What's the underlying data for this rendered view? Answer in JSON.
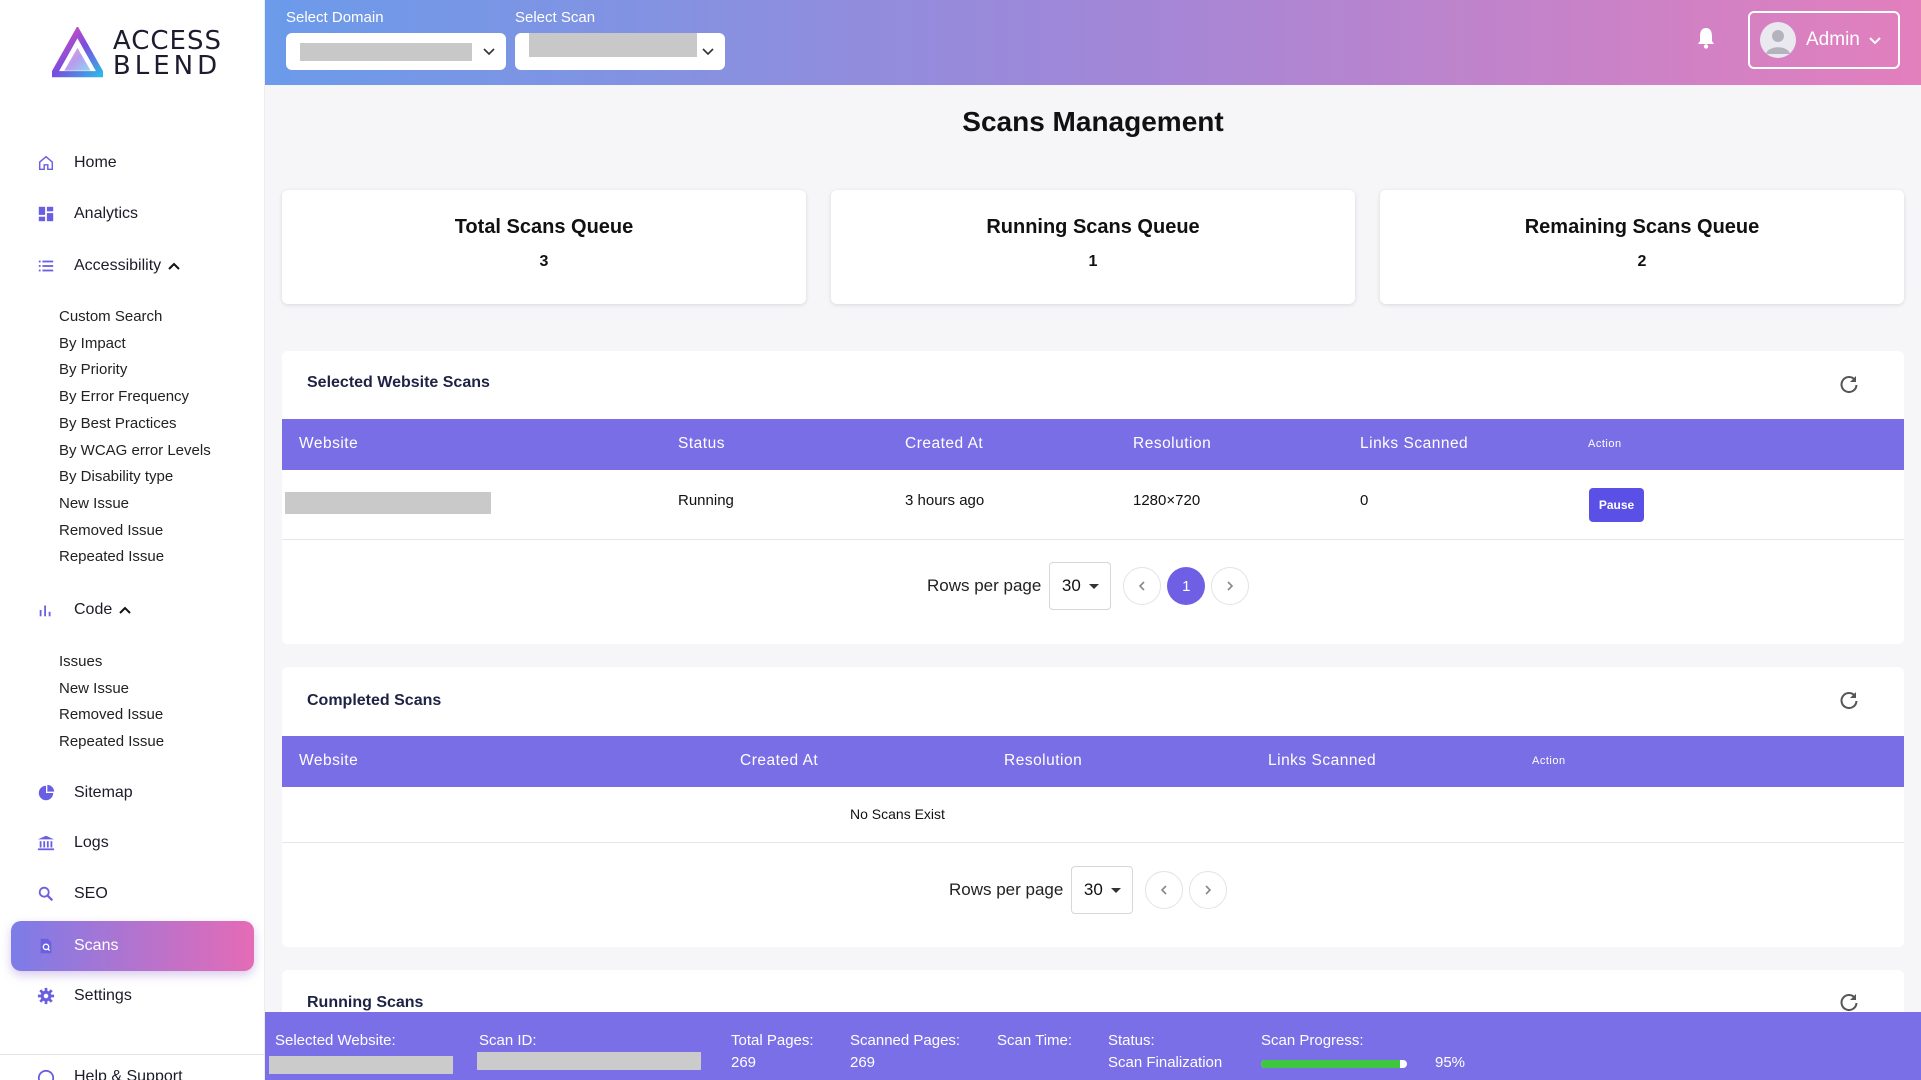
{
  "logo": {
    "line1": "ACCESS",
    "line2": "BLEND"
  },
  "sidebar": {
    "nav": {
      "home": "Home",
      "analytics": "Analytics",
      "accessibility": "Accessibility",
      "code": "Code",
      "sitemap": "Sitemap",
      "logs": "Logs",
      "seo": "SEO",
      "scans": "Scans",
      "settings": "Settings",
      "help": "Help & Support"
    },
    "accessibility_items": [
      "Custom Search",
      "By Impact",
      "By Priority",
      "By Error Frequency",
      "By Best Practices",
      "By WCAG error Levels",
      "By Disability type",
      "New Issue",
      "Removed Issue",
      "Repeated Issue"
    ],
    "code_items": [
      "Issues",
      "New Issue",
      "Removed Issue",
      "Repeated Issue"
    ]
  },
  "header": {
    "select_domain_label": "Select Domain",
    "select_scan_label": "Select Scan",
    "user": "Admin"
  },
  "page_title": "Scans Management",
  "stats": [
    {
      "title": "Total Scans Queue",
      "value": "3"
    },
    {
      "title": "Running Scans Queue",
      "value": "1"
    },
    {
      "title": "Remaining Scans Queue",
      "value": "2"
    }
  ],
  "selected_scans": {
    "title": "Selected Website Scans",
    "columns": [
      "Website",
      "Status",
      "Created At",
      "Resolution",
      "Links Scanned",
      "Action"
    ],
    "row": {
      "status": "Running",
      "created_at": "3 hours ago",
      "resolution": "1280×720",
      "links_scanned": "0",
      "action": "Pause"
    },
    "rows_per_page_label": "Rows per page",
    "rows_per_page": "30",
    "current_page": "1"
  },
  "completed_scans": {
    "title": "Completed Scans",
    "columns": [
      "Website",
      "Created At",
      "Resolution",
      "Links Scanned",
      "Action"
    ],
    "empty": "No Scans Exist",
    "rows_per_page_label": "Rows per page",
    "rows_per_page": "30"
  },
  "running_scans": {
    "title": "Running Scans"
  },
  "status_bar": {
    "selected_website_label": "Selected Website:",
    "scan_id_label": "Scan ID:",
    "total_pages_label": "Total Pages:",
    "total_pages": "269",
    "scanned_pages_label": "Scanned Pages:",
    "scanned_pages": "269",
    "scan_time_label": "Scan Time:",
    "status_label": "Status:",
    "status": "Scan Finalization",
    "progress_label": "Scan Progress:",
    "progress": "95%",
    "progress_fraction": 0.95
  },
  "colors": {
    "accent": "#7a6ee6",
    "progress": "#3fc63f"
  }
}
